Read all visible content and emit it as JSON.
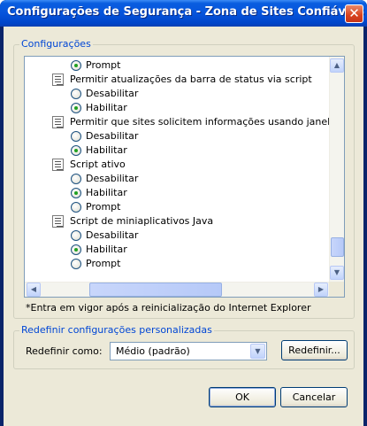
{
  "window": {
    "title": "Configurações de Segurança - Zona de Sites Confiáveis",
    "close_glyph": "✕"
  },
  "settings_group": {
    "legend": "Configurações"
  },
  "settings_list": {
    "items": [
      {
        "kind": "option",
        "label": "Prompt",
        "checked": true
      },
      {
        "kind": "heading",
        "label": "Permitir atualizações da barra de status via script"
      },
      {
        "kind": "option",
        "label": "Desabilitar",
        "checked": false
      },
      {
        "kind": "option",
        "label": "Habilitar",
        "checked": true
      },
      {
        "kind": "heading",
        "label": "Permitir que sites solicitem informações usando janelas contro"
      },
      {
        "kind": "option",
        "label": "Desabilitar",
        "checked": false
      },
      {
        "kind": "option",
        "label": "Habilitar",
        "checked": true
      },
      {
        "kind": "heading",
        "label": "Script ativo"
      },
      {
        "kind": "option",
        "label": "Desabilitar",
        "checked": false
      },
      {
        "kind": "option",
        "label": "Habilitar",
        "checked": true
      },
      {
        "kind": "option",
        "label": "Prompt",
        "checked": false
      },
      {
        "kind": "heading",
        "label": "Script de miniaplicativos Java"
      },
      {
        "kind": "option",
        "label": "Desabilitar",
        "checked": false
      },
      {
        "kind": "option",
        "label": "Habilitar",
        "checked": true
      },
      {
        "kind": "option",
        "label": "Prompt",
        "checked": false
      }
    ],
    "vertical_scroll_position": 0.95,
    "horizontal_scroll_position": 0.35
  },
  "note": "*Entra em vigor após a reinicialização do Internet Explorer",
  "reset_group": {
    "legend": "Redefinir configurações personalizadas",
    "label": "Redefinir como:",
    "selected": "Médio (padrão)",
    "reset_button": "Redefinir..."
  },
  "buttons": {
    "ok": "OK",
    "cancel": "Cancelar"
  },
  "icons": {
    "radio": "radio-button-icon",
    "script": "script-setting-icon",
    "scroll_up": "scroll-up-icon",
    "scroll_down": "scroll-down-icon",
    "scroll_left": "scroll-left-icon",
    "scroll_right": "scroll-right-icon",
    "dropdown": "chevron-down-icon"
  }
}
